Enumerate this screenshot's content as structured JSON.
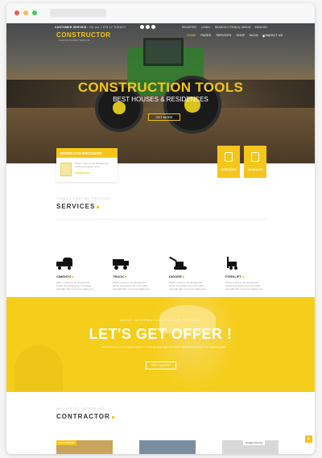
{
  "header": {
    "customer_service_label": "CUSTOMER SERVICE:",
    "phone": "+00 xxx 7 878 12 TURKEY",
    "top_links": [
      "REGISTER",
      "LOGIN",
      "SEARCH"
    ],
    "items_label": "1 ITEM(S) / $99.00",
    "language": "ENGLISH",
    "logo_text": "CONSTRUCTOR",
    "logo_tagline": "BUILDING COMPANY TEMPLATE",
    "nav": [
      "HOME",
      "PAGES",
      "SERVICES",
      "SHOP",
      "BLOG",
      "CONTACT US"
    ],
    "nav_icons": [
      "bag-icon",
      "menu-icon"
    ]
  },
  "hero": {
    "title": "CONSTRUCTION TOOLS",
    "subtitle": "BEST HOUSES & RESIDENCES",
    "button": "GET MORE"
  },
  "brochure": {
    "title": "DOWNLOAD BROCHURE",
    "text": "When I came to be showed the books and papers from",
    "link": "DOWNLOAD"
  },
  "quick_boxes": [
    "SERVICES",
    "VEHICLES"
  ],
  "services_section": {
    "caption": "THINGS THAT WE PROVIDE",
    "title": "SERVICES",
    "items": [
      {
        "name": "CIMENTO",
        "icon": "cement-truck-icon",
        "desc": "When I came to be showed the books and papers from the table, and with that I went into place and"
      },
      {
        "name": "TRUCK",
        "icon": "dump-truck-icon",
        "desc": "When I came to be showed the books and papers from the table, and with that I went into place and"
      },
      {
        "name": "DIGGER",
        "icon": "excavator-icon",
        "desc": "When I came to be showed the books and papers from the table, and with that I went into place and"
      },
      {
        "name": "FORKLIFT",
        "icon": "forklift-icon",
        "desc": "When I came to be showed the books and papers from the table, and with that I went into place and"
      }
    ]
  },
  "offer": {
    "caption": "MORE INFORMATION FILL UP TO FORM",
    "title": "LET'S GET OFFER !",
    "desc": "The Residence is at a strategic location in a fast growing urban area which further from the city of the pleasant quality",
    "button": "GET QUOTE"
  },
  "contractor": {
    "caption": "WE LIKE TO INTRODUCE",
    "title": "CONTRACTOR",
    "card_tags": [
      "MAIN OFFICE",
      "Google Chrome"
    ]
  },
  "colors": {
    "accent": "#f5c61a",
    "dark": "#1e1c18"
  }
}
